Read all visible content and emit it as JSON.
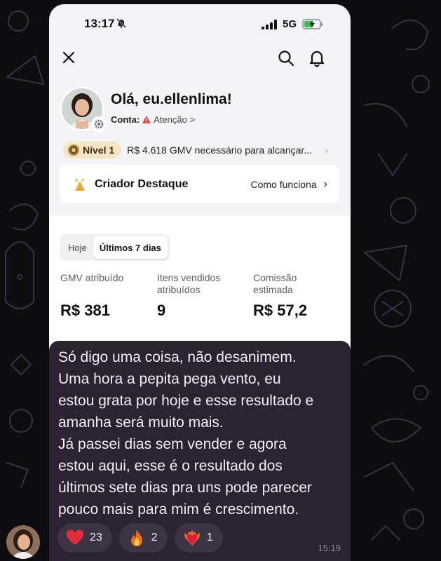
{
  "status_bar": {
    "time": "13:17",
    "network": "5G"
  },
  "profile": {
    "greeting": "Olá, eu.ellenlima!",
    "account_label": "Conta:",
    "account_status": "Atenção >"
  },
  "level": {
    "label": "Nível 1",
    "text": "R$ 4.618 GMV necessário para alcançar..."
  },
  "creator": {
    "title": "Criador Destaque",
    "link": "Como funciona"
  },
  "period_tabs": [
    "Hoje",
    "Últimos 7 dias"
  ],
  "metrics": [
    {
      "label_line1": "GMV atribuído",
      "label_line2": "",
      "value": "R$ 381"
    },
    {
      "label_line1": "Itens vendidos",
      "label_line2": "atribuídos",
      "value": "9"
    },
    {
      "label_line1": "Comissão",
      "label_line2": "estimada",
      "value": "R$ 57,2"
    }
  ],
  "message": {
    "lines": [
      "Só digo uma coisa, não desanimem.",
      "Uma hora a pepita pega vento, eu",
      "estou grata por hoje e esse resultado e",
      "amanha será muito mais.",
      "Já passei dias sem vender e agora",
      "estou aqui, esse é o resultado dos",
      "últimos sete dias pra uns pode parecer",
      "pouco mais para mim é crescimento."
    ],
    "time": "15:19",
    "reactions": [
      {
        "emoji": "red-heart",
        "count": "23"
      },
      {
        "emoji": "fire",
        "count": "2"
      },
      {
        "emoji": "heart-on-fire",
        "count": "1"
      }
    ]
  },
  "colors": {
    "chat_background": "#0d0c0f",
    "bubble": "#2b2232",
    "reaction_pill": "#3c3344",
    "app_background": "#f4f4f6",
    "level_pill": "#f6e6c6",
    "warning": "#e0443a"
  }
}
